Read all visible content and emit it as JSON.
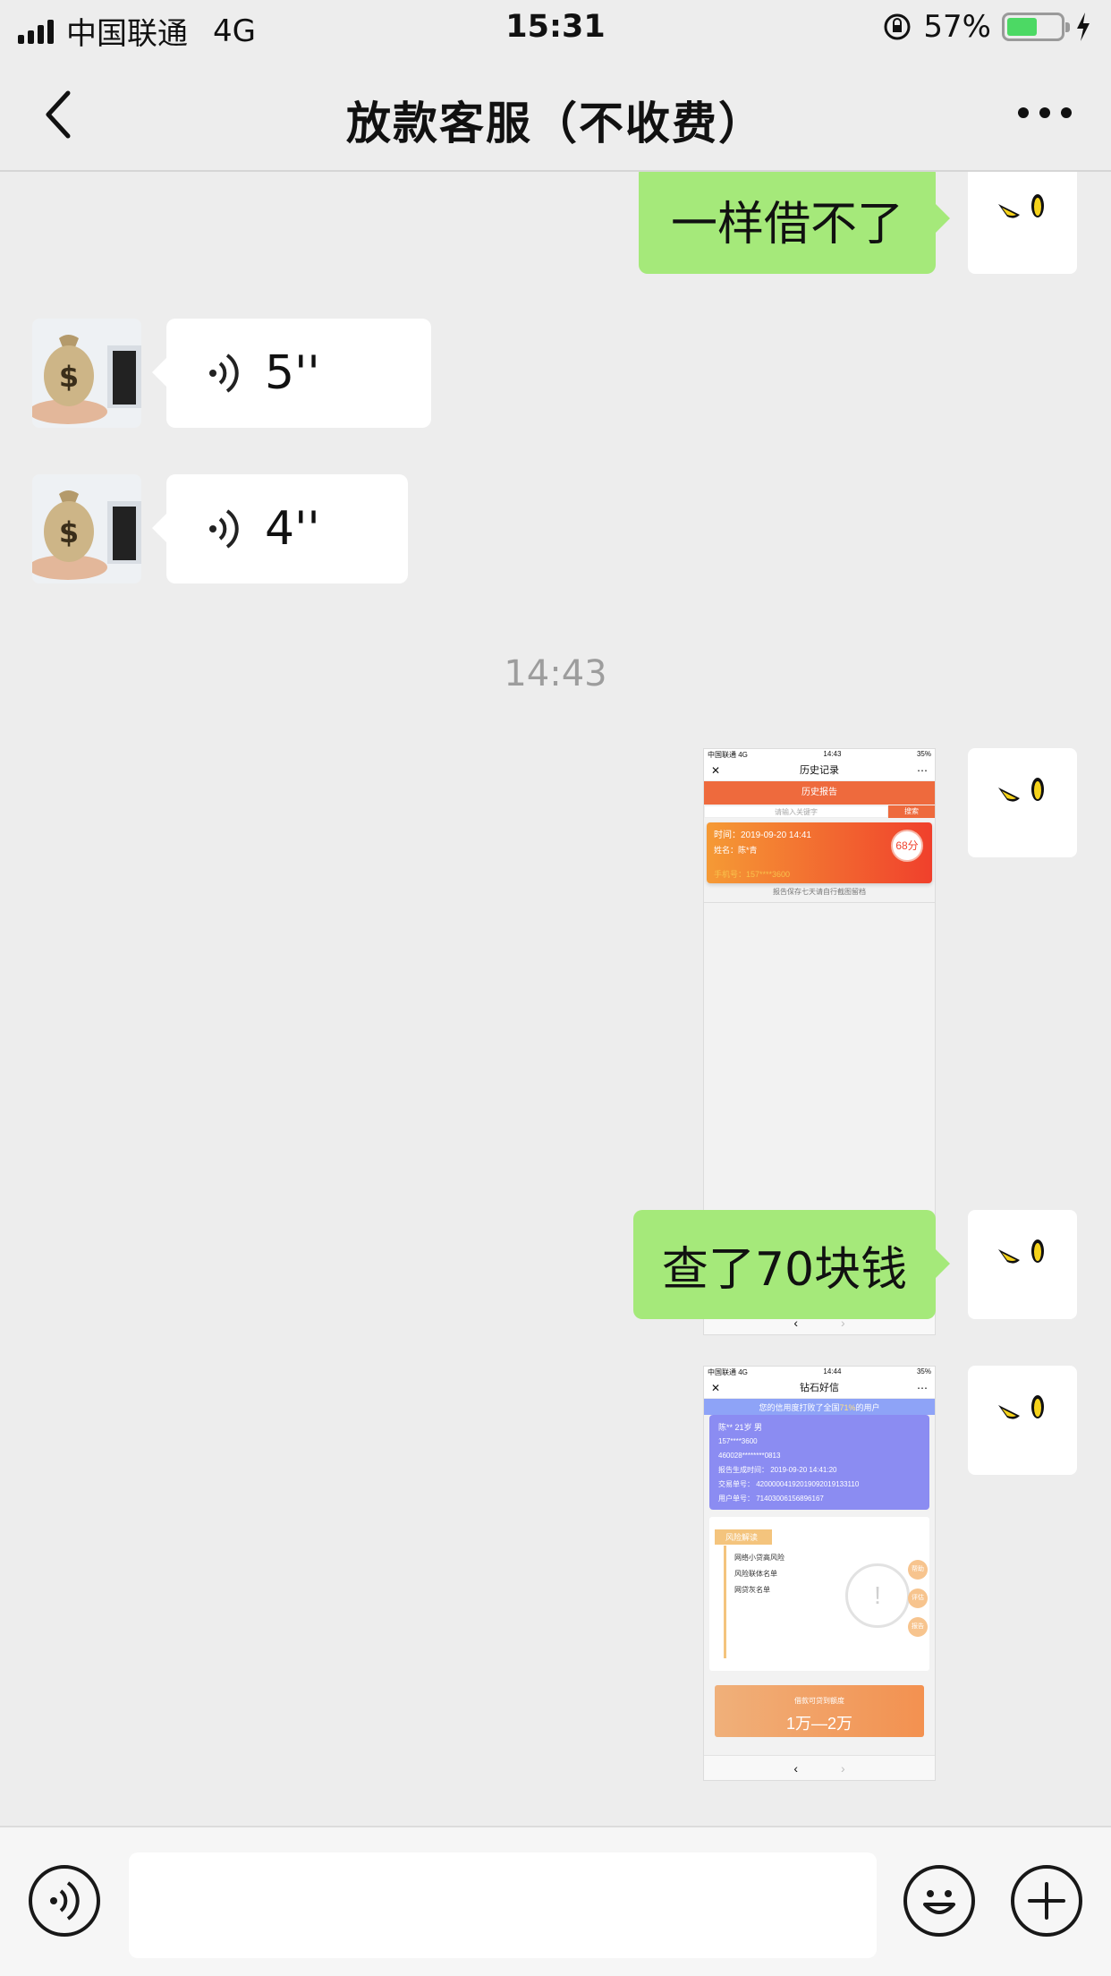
{
  "status_bar": {
    "carrier": "中国联通",
    "network": "4G",
    "time": "15:31",
    "battery": "57%",
    "battery_level": 0.57
  },
  "nav": {
    "title": "放款客服（不收费）"
  },
  "messages": [
    {
      "side": "self",
      "type": "text",
      "text": "一样借不了"
    },
    {
      "side": "peer",
      "type": "voice",
      "duration": "5''"
    },
    {
      "side": "peer",
      "type": "voice",
      "duration": "4''"
    },
    {
      "type": "timestamp",
      "text": "14:43"
    },
    {
      "side": "self",
      "type": "image"
    },
    {
      "side": "self",
      "type": "text",
      "text": "查了70块钱"
    },
    {
      "side": "self",
      "type": "image"
    }
  ],
  "screenshot1": {
    "carrier": "中国联通  4G",
    "time": "14:43",
    "battery": "35%",
    "title": "历史记录",
    "header": "历史报告",
    "search_placeholder": "请输入关键字",
    "search_button": "搜索",
    "record_time": "时间：2019-09-20 14:41",
    "record_name": "姓名：陈*青",
    "record_score": "68分",
    "record_phone": "手机号：157****3600",
    "note": "报告保存七天请自行截图留档"
  },
  "screenshot2": {
    "carrier": "中国联通  4G",
    "time": "14:44",
    "battery": "35%",
    "title": "钻石好信",
    "band_text_pre": "您的信用度打败了全国",
    "band_text_pct": "71%",
    "band_text_post": "的用户",
    "card_name": "陈**  21岁  男",
    "card_phone": "157****3600",
    "card_id": "460028********0813",
    "card_report_time": "报告生成时间：  2019-09-20 14:41:20",
    "card_trade_no": "交易单号：  42000004192019092019133110",
    "card_user_no": "用户单号：  71403006156896167",
    "risk_tag": "风险解读",
    "risk_items": [
      "网络小贷高风险",
      "风险联体名单",
      "网贷灰名单"
    ],
    "risk_badges": [
      "帮助",
      "评估",
      "报告"
    ],
    "amount_label": "借款可贷到额度",
    "amount_value": "1万—2万"
  },
  "icons": {
    "back": "chevron-left-icon",
    "more": "more-dots-icon",
    "voice": "voice-wave-icon",
    "emoji": "emoji-icon",
    "plus": "plus-icon"
  },
  "colors": {
    "self_bubble": "#a5e97a",
    "peer_bubble": "#ffffff",
    "background": "#ededed",
    "battery_fill": "#4cd964"
  }
}
